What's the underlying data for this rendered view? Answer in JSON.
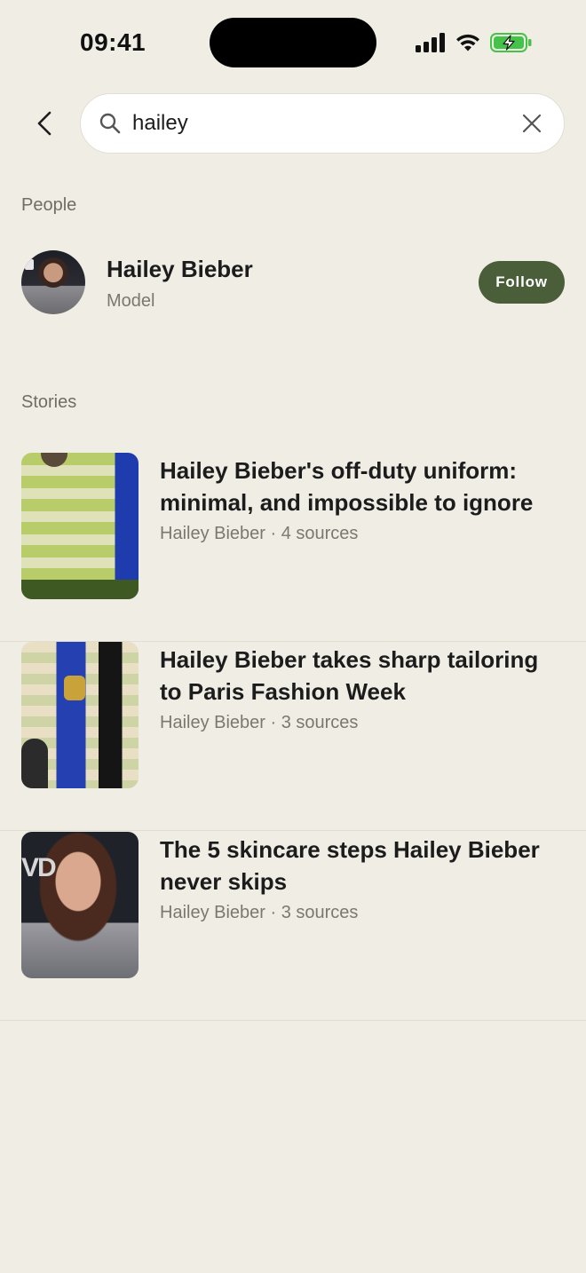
{
  "status_bar": {
    "time": "09:41",
    "icons": [
      "cellular-signal-icon",
      "wifi-icon",
      "battery-charging-icon"
    ],
    "battery_color": "#45c24a"
  },
  "search": {
    "query": "hailey",
    "icons": {
      "back": "back-arrow-icon",
      "search": "search-icon",
      "clear": "close-icon"
    }
  },
  "people": {
    "label": "People",
    "items": [
      {
        "name": "Hailey Bieber",
        "role": "Model",
        "follow_label": "Follow"
      }
    ]
  },
  "stories": {
    "label": "Stories",
    "items": [
      {
        "title": "Hailey Bieber's off-duty uniform: minimal, and impossible to ignore",
        "meta": "Hailey Bieber · 4 sources"
      },
      {
        "title": "Hailey Bieber takes sharp tailoring to Paris Fashion Week",
        "meta": "Hailey Bieber · 3 sources"
      },
      {
        "title": "The 5 skincare steps Hailey Bieber never skips",
        "meta": "Hailey Bieber · 3 sources"
      }
    ]
  },
  "colors": {
    "background": "#f0ede4",
    "follow_button": "#4b5e3a",
    "text_primary": "#1c1c1c",
    "text_secondary": "#7a7870"
  }
}
